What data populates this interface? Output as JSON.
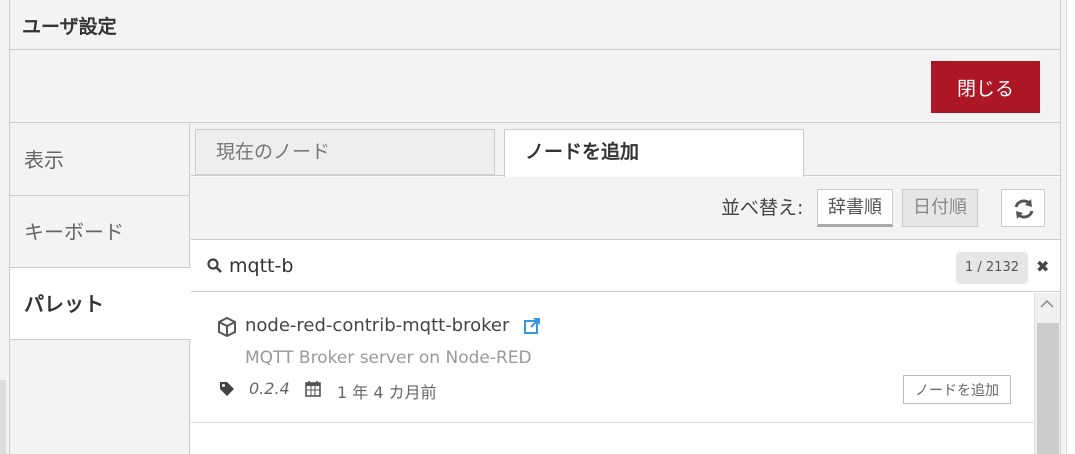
{
  "dialog": {
    "title": "ユーザ設定",
    "close_label": "閉じる"
  },
  "sidebar": {
    "items": [
      {
        "label": "表示"
      },
      {
        "label": "キーボード"
      },
      {
        "label": "パレット"
      }
    ]
  },
  "tabs": [
    {
      "label": "現在のノード"
    },
    {
      "label": "ノードを追加"
    }
  ],
  "sort": {
    "label": "並べ替え:",
    "options": [
      "辞書順",
      "日付順"
    ],
    "selected": "辞書順"
  },
  "search": {
    "value": "mqtt-b",
    "count": "1 / 2132"
  },
  "results": [
    {
      "name": "node-red-contrib-mqtt-broker",
      "description": "MQTT Broker server on Node-RED",
      "version": "0.2.4",
      "updated": "1 年 4 カ月前",
      "install_label": "ノードを追加"
    }
  ],
  "colors": {
    "accent": "#ad1625",
    "link": "#3a96dd"
  }
}
